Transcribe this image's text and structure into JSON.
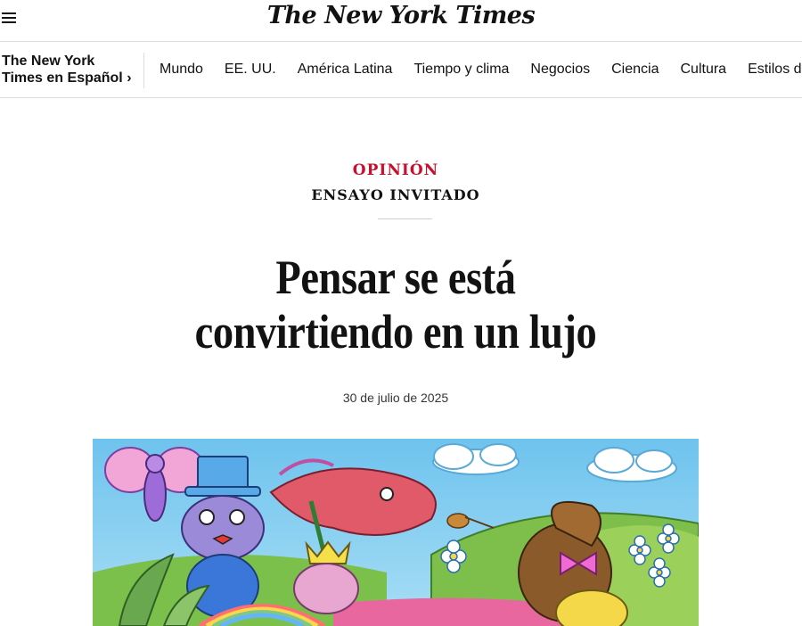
{
  "masthead": {
    "logo_text": "The New York Times",
    "menu_icon": "hamburger-menu-icon"
  },
  "nav": {
    "section_label": "The New York Times en Español",
    "section_chevron": "›",
    "items": [
      "Mundo",
      "EE. UU.",
      "América Latina",
      "Tiempo y clima",
      "Negocios",
      "Ciencia",
      "Cultura",
      "Estilos de vid"
    ]
  },
  "article": {
    "kicker": "OPINIÓN",
    "subkicker": "ENSAYO INVITADO",
    "headline": "Pensar se está convirtiendo en un lujo",
    "date": "30 de julio de 2025",
    "hero_image": "colorful-cartoon-illustration"
  },
  "colors": {
    "opinion_red": "#c8102e",
    "text": "#121212",
    "rule": "#dcdcdc"
  }
}
